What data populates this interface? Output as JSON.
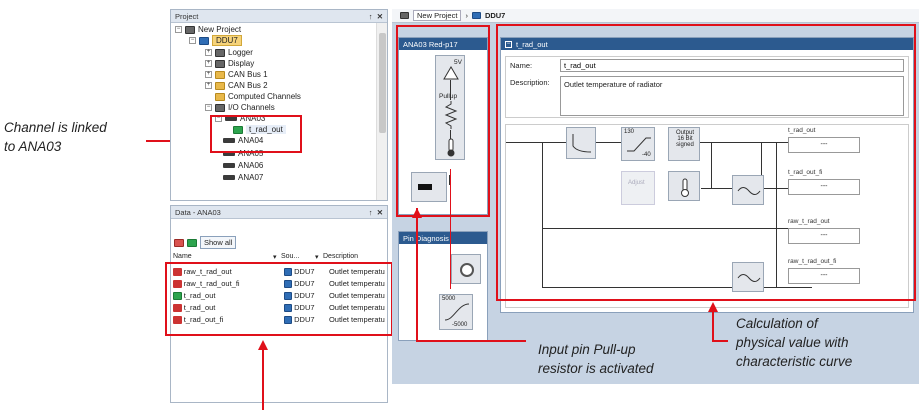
{
  "annotations": {
    "channel_linked_line1": "Channel is linked",
    "channel_linked_line2": "to ANA03",
    "pullup_line1": "Input pin Pull-up",
    "pullup_line2": "resistor is activated",
    "calc_line1": "Calculation of",
    "calc_line2": "physical value with",
    "calc_line3": "characteristic curve"
  },
  "project_panel": {
    "title": "Project",
    "pin_icon": "pin-icon",
    "close_icon": "close-icon",
    "items": [
      {
        "label": "New Project"
      },
      {
        "label": "DDU7"
      },
      {
        "label": "Logger"
      },
      {
        "label": "Display"
      },
      {
        "label": "CAN Bus 1"
      },
      {
        "label": "CAN Bus 2"
      },
      {
        "label": "Computed Channels"
      },
      {
        "label": "I/O Channels"
      },
      {
        "label": "ANA03"
      },
      {
        "label": "t_rad_out"
      },
      {
        "label": "ANA04"
      },
      {
        "label": "ANA05"
      },
      {
        "label": "ANA06"
      },
      {
        "label": "ANA07"
      }
    ]
  },
  "data_panel": {
    "title": "Data - ANA03",
    "show_all": "Show all",
    "columns": [
      "Name",
      "Sou...",
      "Description"
    ],
    "rows": [
      {
        "name": "raw_t_rad_out",
        "source": "DDU7",
        "description": "Outlet temperatu"
      },
      {
        "name": "raw_t_rad_out_fi",
        "source": "DDU7",
        "description": "Outlet temperatu"
      },
      {
        "name": "t_rad_out",
        "source": "DDU7",
        "description": "Outlet temperatu"
      },
      {
        "name": "t_rad_out",
        "source": "DDU7",
        "description": "Outlet temperatu"
      },
      {
        "name": "t_rad_out_fi",
        "source": "DDU7",
        "description": "Outlet temperatu"
      }
    ]
  },
  "breadcrumb": {
    "project": "New Project",
    "device": "DDU7"
  },
  "pin_card": {
    "title": "ANA03 Red-p17",
    "supply": "5V",
    "pullup": "Pullup"
  },
  "diag_card": {
    "title": "Pin Diagnosis",
    "curve_top": "5000",
    "curve_bottom": "-5000"
  },
  "channel_card": {
    "title": "t_rad_out",
    "name_label": "Name:",
    "name_value": "t_rad_out",
    "desc_label": "Description:",
    "desc_value": "Outlet temperature of radiator",
    "curve_top": "130",
    "curve_bottom": "-40",
    "output_label": "Output\n16 Bit\nsigned",
    "adjust_label": "Adjust",
    "outputs": [
      {
        "label": "t_rad_out",
        "value": "---"
      },
      {
        "label": "t_rad_out_fi",
        "value": "---"
      },
      {
        "label": "raw_t_rad_out",
        "value": "---"
      },
      {
        "label": "raw_t_rad_out_fi",
        "value": "---"
      }
    ]
  },
  "colors": {
    "accent": "#e0101a",
    "header": "#2c5a8f",
    "workspace": "#c6d3e3"
  }
}
